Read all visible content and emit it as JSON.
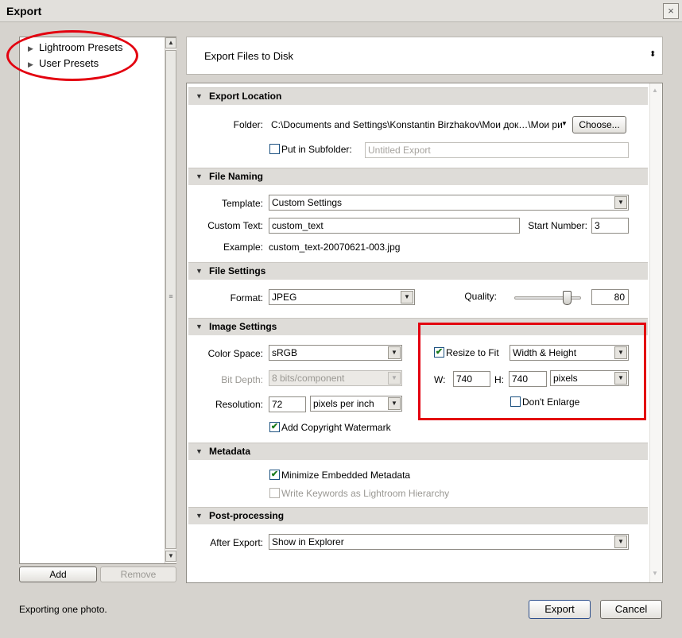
{
  "window": {
    "title": "Export",
    "close_glyph": "×"
  },
  "presets": {
    "items": [
      "Lightroom Presets",
      "User Presets"
    ],
    "add_label": "Add",
    "remove_label": "Remove"
  },
  "export_type": {
    "label": "Export Files to Disk"
  },
  "sections": {
    "export_location": {
      "title": "Export Location",
      "folder_label": "Folder:",
      "folder_value": "C:\\Documents and Settings\\Konstantin Birzhakov\\Мои док…\\Мои рисунки",
      "choose_label": "Choose...",
      "subfolder_label": "Put in Subfolder:",
      "subfolder_checked": false,
      "subfolder_placeholder": "Untitled Export"
    },
    "file_naming": {
      "title": "File Naming",
      "template_label": "Template:",
      "template_value": "Custom Settings",
      "custom_text_label": "Custom Text:",
      "custom_text_value": "custom_text",
      "start_number_label": "Start Number:",
      "start_number_value": "3",
      "example_label": "Example:",
      "example_value": "custom_text-20070621-003.jpg"
    },
    "file_settings": {
      "title": "File Settings",
      "format_label": "Format:",
      "format_value": "JPEG",
      "quality_label": "Quality:",
      "quality_value": "80",
      "quality_fraction": 0.8
    },
    "image_settings": {
      "title": "Image Settings",
      "color_space_label": "Color Space:",
      "color_space_value": "sRGB",
      "bit_depth_label": "Bit Depth:",
      "bit_depth_value": "8 bits/component",
      "resolution_label": "Resolution:",
      "resolution_value": "72",
      "resolution_unit": "pixels per inch",
      "watermark_label": "Add Copyright Watermark",
      "watermark_checked": true,
      "resize_label": "Resize to Fit",
      "resize_checked": true,
      "resize_mode": "Width & Height",
      "w_label": "W:",
      "w_value": "740",
      "h_label": "H:",
      "h_value": "740",
      "size_unit": "pixels",
      "dont_enlarge_label": "Don't Enlarge",
      "dont_enlarge_checked": false
    },
    "metadata": {
      "title": "Metadata",
      "minimize_label": "Minimize Embedded Metadata",
      "minimize_checked": true,
      "keywords_label": "Write Keywords as Lightroom Hierarchy",
      "keywords_checked": false
    },
    "post_processing": {
      "title": "Post-processing",
      "after_export_label": "After Export:",
      "after_export_value": "Show in Explorer"
    }
  },
  "footer": {
    "status": "Exporting one photo.",
    "export_label": "Export",
    "cancel_label": "Cancel"
  },
  "colors": {
    "annotation_red": "#e3000f",
    "check_green": "#1a7a1a"
  }
}
